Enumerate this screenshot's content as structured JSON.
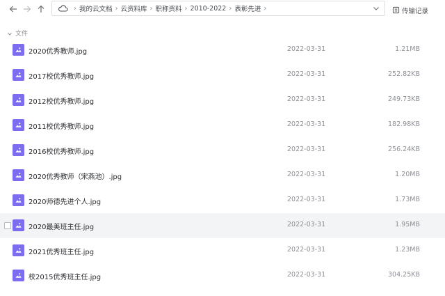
{
  "toolbar": {
    "breadcrumbs": [
      "我的云文档",
      "云资料库",
      "职称资料",
      "2010-2022",
      "表彰先进"
    ],
    "history_label": "传输记录"
  },
  "section": {
    "label": "文件"
  },
  "colors": {
    "image_icon": "#7c6cf0",
    "hover_row": "#f3f4f5",
    "border": "#dcdde0"
  },
  "files": [
    {
      "name": "2020优秀教师.jpg",
      "date": "2022-03-31",
      "size": "1.21MB",
      "icon": "image-icon"
    },
    {
      "name": "2017校优秀教师.jpg",
      "date": "2022-03-31",
      "size": "252.82KB",
      "icon": "image-icon"
    },
    {
      "name": "2012校优秀教师.jpg",
      "date": "2022-03-31",
      "size": "249.73KB",
      "icon": "image-icon"
    },
    {
      "name": "2011校优秀教师.jpg",
      "date": "2022-03-31",
      "size": "182.98KB",
      "icon": "image-icon"
    },
    {
      "name": "2016校优秀教师.jpg",
      "date": "2022-03-31",
      "size": "256.24KB",
      "icon": "image-icon"
    },
    {
      "name": "2020优秀教师（宋燕池）.jpg",
      "date": "2022-03-31",
      "size": "1.20MB",
      "icon": "image-icon"
    },
    {
      "name": "2020师德先进个人.jpg",
      "date": "2022-03-31",
      "size": "1.73MB",
      "icon": "image-icon"
    },
    {
      "name": "2020最美班主任.jpg",
      "date": "2022-03-31",
      "size": "1.95MB",
      "icon": "image-icon"
    },
    {
      "name": "2021优秀班主任.jpg",
      "date": "2022-03-31",
      "size": "1.23MB",
      "icon": "image-icon"
    },
    {
      "name": "校2015优秀班主任.jpg",
      "date": "2022-03-31",
      "size": "304.25KB",
      "icon": "image-icon"
    }
  ]
}
